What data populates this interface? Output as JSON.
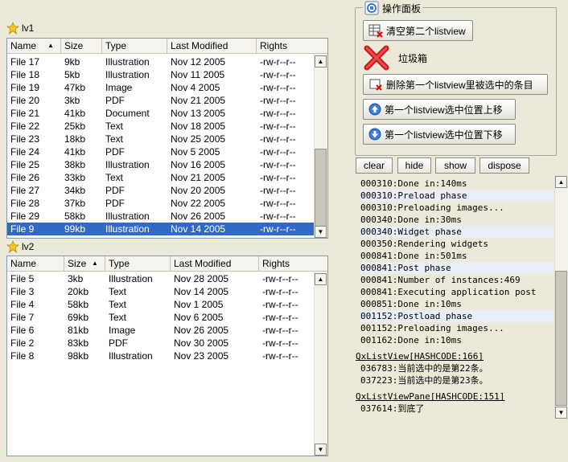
{
  "lv1": {
    "title": "lv1",
    "columns": [
      "Name",
      "Size",
      "Type",
      "Last Modified",
      "Rights"
    ],
    "sort_column": "Name",
    "rows": [
      [
        "File 17",
        "9kb",
        "Illustration",
        "Nov 12 2005",
        "-rw-r--r--"
      ],
      [
        "File 18",
        "5kb",
        "Illustration",
        "Nov 11 2005",
        "-rw-r--r--"
      ],
      [
        "File 19",
        "47kb",
        "Image",
        "Nov 4 2005",
        "-rw-r--r--"
      ],
      [
        "File 20",
        "3kb",
        "PDF",
        "Nov 21 2005",
        "-rw-r--r--"
      ],
      [
        "File 21",
        "41kb",
        "Document",
        "Nov 13 2005",
        "-rw-r--r--"
      ],
      [
        "File 22",
        "25kb",
        "Text",
        "Nov 18 2005",
        "-rw-r--r--"
      ],
      [
        "File 23",
        "18kb",
        "Text",
        "Nov 25 2005",
        "-rw-r--r--"
      ],
      [
        "File 24",
        "41kb",
        "PDF",
        "Nov 5 2005",
        "-rw-r--r--"
      ],
      [
        "File 25",
        "38kb",
        "Illustration",
        "Nov 16 2005",
        "-rw-r--r--"
      ],
      [
        "File 26",
        "33kb",
        "Text",
        "Nov 21 2005",
        "-rw-r--r--"
      ],
      [
        "File 27",
        "34kb",
        "PDF",
        "Nov 20 2005",
        "-rw-r--r--"
      ],
      [
        "File 28",
        "37kb",
        "PDF",
        "Nov 22 2005",
        "-rw-r--r--"
      ],
      [
        "File 29",
        "58kb",
        "Illustration",
        "Nov 26 2005",
        "-rw-r--r--"
      ],
      [
        "File 9",
        "99kb",
        "Illustration",
        "Nov 14 2005",
        "-rw-r--r--"
      ]
    ],
    "selected_index": 13
  },
  "lv2": {
    "title": "lv2",
    "columns": [
      "Name",
      "Size",
      "Type",
      "Last Modified",
      "Rights"
    ],
    "sort_column": "Size",
    "rows": [
      [
        "File 5",
        "3kb",
        "Illustration",
        "Nov 28 2005",
        "-rw-r--r--"
      ],
      [
        "File 3",
        "20kb",
        "Text",
        "Nov 14 2005",
        "-rw-r--r--"
      ],
      [
        "File 4",
        "58kb",
        "Text",
        "Nov 1 2005",
        "-rw-r--r--"
      ],
      [
        "File 7",
        "69kb",
        "Text",
        "Nov 6 2005",
        "-rw-r--r--"
      ],
      [
        "File 6",
        "81kb",
        "Image",
        "Nov 26 2005",
        "-rw-r--r--"
      ],
      [
        "File 2",
        "83kb",
        "PDF",
        "Nov 30 2005",
        "-rw-r--r--"
      ],
      [
        "File 8",
        "98kb",
        "Illustration",
        "Nov 23 2005",
        "-rw-r--r--"
      ]
    ]
  },
  "panel": {
    "title": "操作面板",
    "clear_lv2_label": "清空第二个listview",
    "trash_label": "垃圾箱",
    "delete_selected_label": "删除第一个listview里被选中的条目",
    "move_up_label": "第一个listview选中位置上移",
    "move_down_label": "第一个listview选中位置下移"
  },
  "debug": {
    "clear_label": "clear",
    "hide_label": "hide",
    "show_label": "show",
    "dispose_label": "dispose",
    "log": [
      {
        "text": "000310:Done in:140ms",
        "hl": false
      },
      {
        "text": "000310:Preload phase",
        "hl": true
      },
      {
        "text": "000310:Preloading images...",
        "hl": false
      },
      {
        "text": "000340:Done in:30ms",
        "hl": false
      },
      {
        "text": "000340:Widget phase",
        "hl": true
      },
      {
        "text": "000350:Rendering widgets",
        "hl": false
      },
      {
        "text": "000841:Done in:501ms",
        "hl": false
      },
      {
        "text": "000841:Post phase",
        "hl": true
      },
      {
        "text": "000841:Number of instances:469",
        "hl": false
      },
      {
        "text": "000841:Executing application post",
        "hl": false
      },
      {
        "text": "000851:Done in:10ms",
        "hl": false
      },
      {
        "text": "001152:Postload phase",
        "hl": true
      },
      {
        "text": "001152:Preloading images...",
        "hl": false
      },
      {
        "text": "001162:Done in:10ms",
        "hl": false
      }
    ],
    "group1_title": "QxListView[HASHCODE:166]",
    "group1_lines": [
      "036783:当前选中的是第22条。",
      "037223:当前选中的是第23条。"
    ],
    "group2_title": "QxListViewPane[HASHCODE:151]",
    "group2_lines": [
      "037614:到底了"
    ]
  },
  "colors": {
    "selection": "#316ac5",
    "background": "#ece9d8",
    "border": "#7f9db9"
  }
}
